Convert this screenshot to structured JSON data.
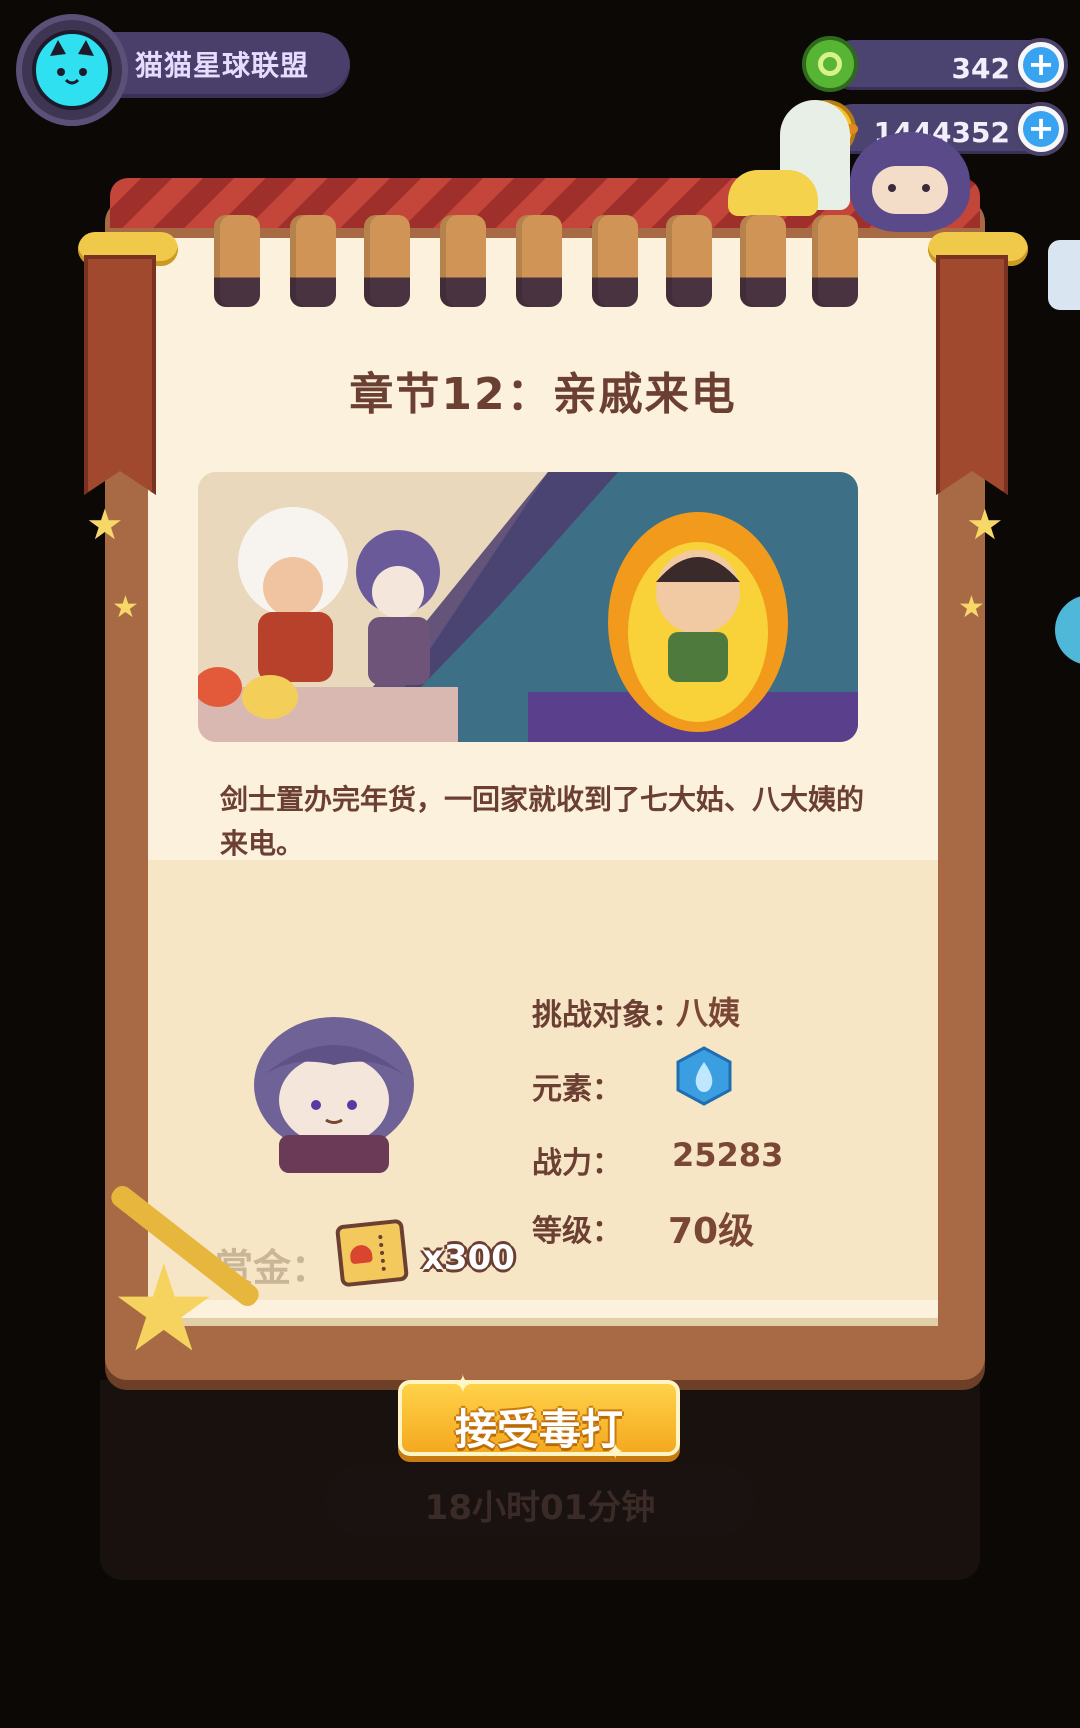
{
  "header": {
    "guild_name": "猫猫星球联盟",
    "currency_green": "342",
    "currency_gold": "1444352"
  },
  "chapter": {
    "title": "章节12：亲戚来电",
    "story": "剑士置办完年货，一回家就收到了七大姑、八大姨的来电。"
  },
  "target": {
    "label_target": "挑战对象：",
    "target_name": "八姨",
    "label_element": "元素：",
    "element_icon": "water-drop-icon",
    "label_power": "战力：",
    "power": "25283",
    "label_level": "等级：",
    "level": "70级"
  },
  "reward": {
    "label": "赏金：",
    "count": "x300"
  },
  "actions": {
    "accept_label": "接受毒打",
    "timer": "18小时01分钟"
  },
  "colors": {
    "accent": "#f4a91f",
    "title_brown": "#6c3f33",
    "element_blue": "#3a9ee0"
  }
}
